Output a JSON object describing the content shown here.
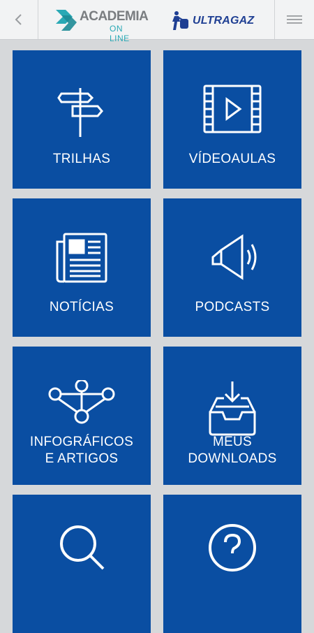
{
  "header": {
    "back_icon": "chevron-left-icon",
    "menu_icon": "hamburger-icon",
    "academia_title": "ACADEMIA",
    "academia_subtitle": "ON LINE",
    "brand": "ULTRAGAZ",
    "colors": {
      "academia_teal": "#2aa9b5",
      "brand_blue": "#1f3f93"
    }
  },
  "tiles": [
    {
      "label": "TRILHAS",
      "icon": "signpost-icon"
    },
    {
      "label": "VÍDEOAULAS",
      "icon": "film-play-icon"
    },
    {
      "label": "NOTÍCIAS",
      "icon": "newspaper-icon"
    },
    {
      "label": "PODCASTS",
      "icon": "speaker-icon"
    },
    {
      "label_line1": "INFOGRÁFICOS",
      "label_line2": "E ARTIGOS",
      "icon": "network-nodes-icon"
    },
    {
      "label_line1": "MEUS",
      "label_line2": "DOWNLOADS",
      "icon": "download-tray-icon"
    },
    {
      "label": "",
      "icon": "search-icon"
    },
    {
      "label": "",
      "icon": "help-question-icon"
    }
  ],
  "colors": {
    "tile_bg": "#0a4ea2",
    "page_bg": "#d6d8da"
  }
}
